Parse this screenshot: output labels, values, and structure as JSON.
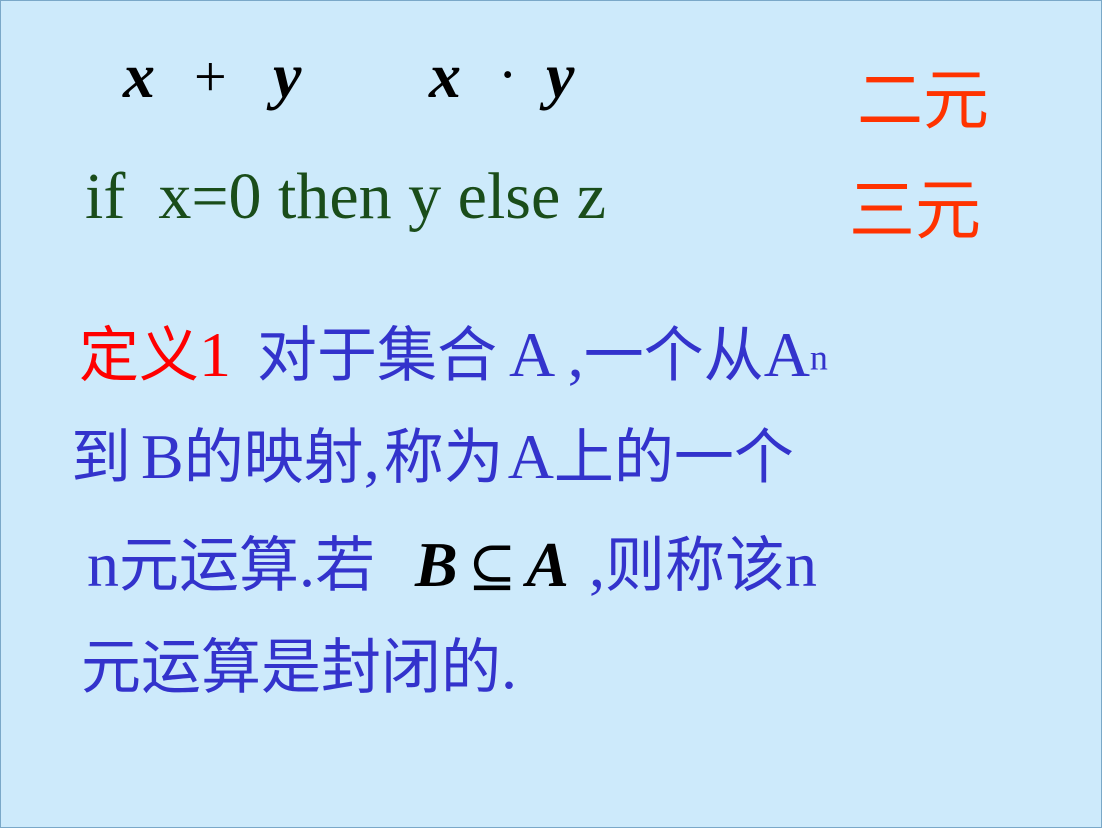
{
  "row1": {
    "x1": "x",
    "plus": "+",
    "y1": "y",
    "x2": "x",
    "dot": "·",
    "y2": "y",
    "label": "二元"
  },
  "row2": {
    "expr": "if  x=0 then y else z",
    "label": "三元"
  },
  "definition": {
    "label": "定义",
    "number": "1",
    "line1_text": "对于集合",
    "line1_A": "A ,",
    "line1_rest": "一个从",
    "line1_An": "A",
    "line1_sup": "n",
    "line2_to": "到",
    "line2_B": "B",
    "line2_mid": "的映射",
    "line2_comma": ",",
    "line2_call": "称为",
    "line2_A": "A",
    "line2_rest": "上的一个",
    "line3_n": "n",
    "line3_text": "元运算",
    "line3_dot": ".",
    "line3_if": "若",
    "line3_B": "B",
    "line3_subseteq": "⊆",
    "line3_A": "A",
    "line3_comma": ",",
    "line3_then": "则称该",
    "line3_n2": "n",
    "line4_text": "元运算是封闭的",
    "line4_dot": "."
  }
}
